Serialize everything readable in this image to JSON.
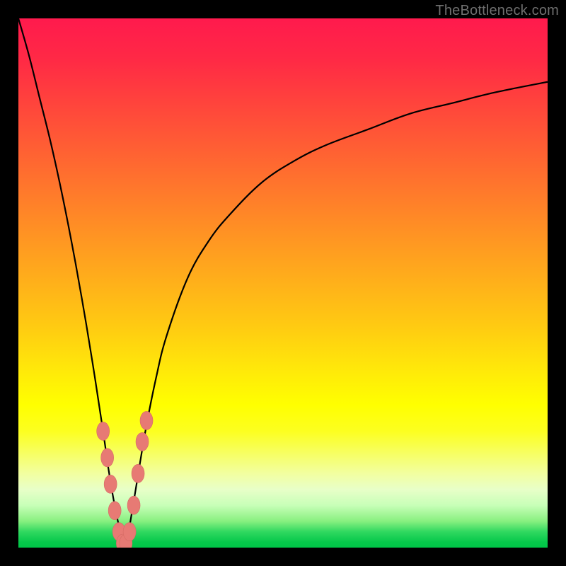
{
  "watermark": {
    "text": "TheBottleneck.com"
  },
  "colors": {
    "curve_stroke": "#000000",
    "marker_fill": "#e77a74",
    "marker_stroke": "#d66b65"
  },
  "chart_data": {
    "type": "line",
    "title": "",
    "xlabel": "",
    "ylabel": "",
    "xlim": [
      0,
      100
    ],
    "ylim": [
      0,
      100
    ],
    "grid": false,
    "series": [
      {
        "name": "bottleneck-curve",
        "x": [
          0,
          2,
          4,
          6,
          8,
          10,
          12,
          14,
          16,
          17,
          18,
          19,
          19.5,
          20,
          20.5,
          21,
          22,
          24,
          26,
          28,
          32,
          36,
          40,
          46,
          52,
          58,
          66,
          74,
          82,
          90,
          100
        ],
        "values": [
          100,
          93,
          85,
          77,
          68,
          58,
          47,
          35,
          22,
          15,
          9,
          4,
          1.5,
          0,
          1.5,
          4,
          10,
          22,
          32,
          40,
          51,
          58,
          63,
          69,
          73,
          76,
          79,
          82,
          84,
          86,
          88
        ]
      }
    ],
    "markers": [
      {
        "x": 16.0,
        "y": 22
      },
      {
        "x": 16.8,
        "y": 17
      },
      {
        "x": 17.4,
        "y": 12
      },
      {
        "x": 18.2,
        "y": 7
      },
      {
        "x": 19.0,
        "y": 3
      },
      {
        "x": 19.7,
        "y": 0.8
      },
      {
        "x": 20.3,
        "y": 0.8
      },
      {
        "x": 21.0,
        "y": 3
      },
      {
        "x": 21.8,
        "y": 8
      },
      {
        "x": 22.6,
        "y": 14
      },
      {
        "x": 23.4,
        "y": 20
      },
      {
        "x": 24.2,
        "y": 24
      }
    ]
  }
}
